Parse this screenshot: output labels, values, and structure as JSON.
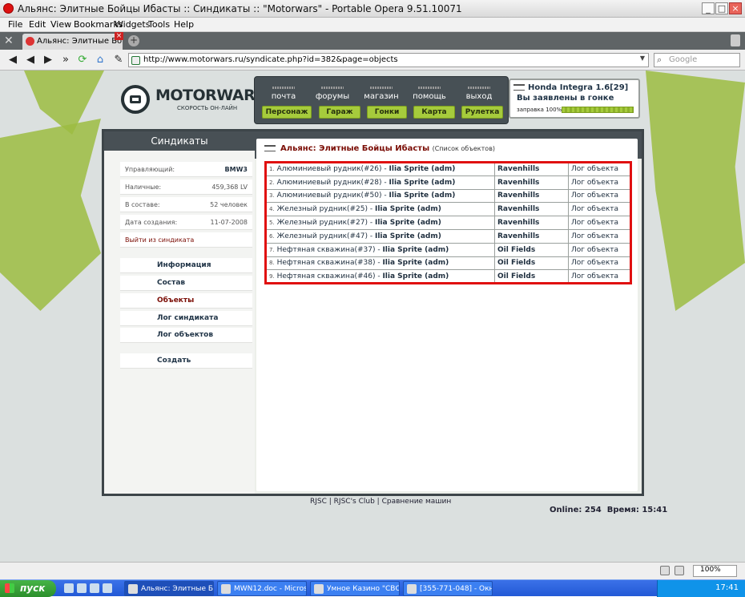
{
  "window": {
    "title": "Альянс: Элитные Бойцы Ибасты :: Синдикаты :: \"Motorwars\" - Portable Opera 9.51.10071",
    "min": "_",
    "max": "□",
    "close": "×"
  },
  "menu": [
    "File",
    "Edit",
    "View",
    "Bookmarks",
    "Widgets",
    "Tools",
    "Help"
  ],
  "tab": {
    "label": "Альянс: Элитные Бойц...",
    "close": "×",
    "new": "+"
  },
  "navbar": {
    "url": "http://www.motorwars.ru/syndicate.php?id=382&page=objects",
    "search_placeholder": "Google",
    "back": "◀",
    "forward": "▶",
    "fastforward": "»",
    "reload": "⟳",
    "home": "⌂"
  },
  "site": {
    "logo_title": "MOTORWARS.RU",
    "logo_sub": "СКОРОСТЬ ОН-ЛАЙН",
    "top_nav": [
      "почта",
      "форумы",
      "магазин",
      "помощь",
      "выход"
    ],
    "sub_nav": [
      "Персонаж",
      "Гараж",
      "Гонки",
      "Карта",
      "Рулетка"
    ],
    "car": {
      "name": "Honda Integra 1.6[29]",
      "status": "Вы заявлены в гонке",
      "fuel_label": "заправка 100%",
      "fuel_level": 100
    }
  },
  "sidebar": {
    "title": "Синдикаты",
    "info": [
      {
        "key": "Управляющий:",
        "value": "BMW3"
      },
      {
        "key": "Наличные:",
        "value": "459,368 LV"
      },
      {
        "key": "В составе:",
        "value": "52 человек"
      },
      {
        "key": "Дата создания:",
        "value": "11-07-2008"
      }
    ],
    "leave": "Выйти из синдиката",
    "links": [
      "Информация",
      "Состав",
      "Объекты",
      "Лог синдиката",
      "Лог объектов"
    ],
    "create": "Создать"
  },
  "main": {
    "title": "Альянс: Элитные Бойцы Ибасты",
    "subtitle": "(Список объектов)",
    "rows": [
      {
        "n": "1.",
        "object": "Алюминиевый рудник(#26) -",
        "owner": "Ilia Sprite (adm)",
        "location": "Ravenhills",
        "log": "Лог объекта"
      },
      {
        "n": "2.",
        "object": "Алюминиевый рудник(#28) -",
        "owner": "Ilia Sprite (adm)",
        "location": "Ravenhills",
        "log": "Лог объекта"
      },
      {
        "n": "3.",
        "object": "Алюминиевый рудник(#50) -",
        "owner": "Ilia Sprite (adm)",
        "location": "Ravenhills",
        "log": "Лог объекта"
      },
      {
        "n": "4.",
        "object": "Железный рудник(#25) -",
        "owner": "Ilia Sprite (adm)",
        "location": "Ravenhills",
        "log": "Лог объекта"
      },
      {
        "n": "5.",
        "object": "Железный рудник(#27) -",
        "owner": "Ilia Sprite (adm)",
        "location": "Ravenhills",
        "log": "Лог объекта"
      },
      {
        "n": "6.",
        "object": "Железный рудник(#47) -",
        "owner": "Ilia Sprite (adm)",
        "location": "Ravenhills",
        "log": "Лог объекта"
      },
      {
        "n": "7.",
        "object": "Нефтяная скважина(#37) -",
        "owner": "Ilia Sprite (adm)",
        "location": "Oil Fields",
        "log": "Лог объекта"
      },
      {
        "n": "8.",
        "object": "Нефтяная скважина(#38) -",
        "owner": "Ilia Sprite (adm)",
        "location": "Oil Fields",
        "log": "Лог объекта"
      },
      {
        "n": "9.",
        "object": "Нефтяная скважина(#46) -",
        "owner": "Ilia Sprite (adm)",
        "location": "Oil Fields",
        "log": "Лог объекта"
      }
    ]
  },
  "footer": {
    "links": [
      "RJSC",
      "RJSC's Club",
      "Сравнение машин"
    ],
    "online": "Online: 254",
    "time": "Время: 15:41"
  },
  "status": {
    "zoom": "100%"
  },
  "taskbar": {
    "start": "пуск",
    "items": [
      "Альянс: Элитные Бо...",
      "MWN12.doc - Microso...",
      "Умное Казино \"СВО...",
      "[355-771-048] - Окн..."
    ],
    "clock": "17:41"
  },
  "colors": {
    "accent_green": "#a6cb3c",
    "panel_dark": "#485055",
    "title_red": "#7b0e06",
    "highlight_red": "#e01010"
  }
}
